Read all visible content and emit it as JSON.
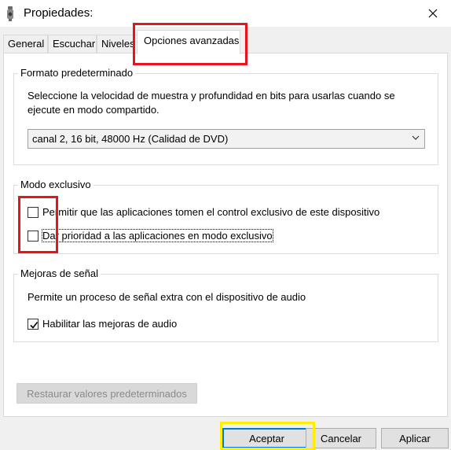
{
  "window": {
    "title": "Propiedades:",
    "icon": "speaker-icon",
    "close_icon": "close-icon"
  },
  "tabs": [
    {
      "label": "General",
      "active": false
    },
    {
      "label": "Escuchar",
      "active": false
    },
    {
      "label": "Niveles",
      "active": false
    },
    {
      "label": "Opciones avanzadas",
      "active": true
    }
  ],
  "default_format": {
    "title": "Formato predeterminado",
    "description": "Seleccione la velocidad de muestra y profundidad en bits para usarlas cuando se ejecute en modo compartido.",
    "selected": "canal 2, 16 bit, 48000 Hz (Calidad de DVD)"
  },
  "exclusive_mode": {
    "title": "Modo exclusivo",
    "allow_exclusive": {
      "label": "Permitir que las aplicaciones tomen el control exclusivo de este dispositivo",
      "checked": false
    },
    "priority": {
      "label": "Dar prioridad a las aplicaciones en modo exclusivo",
      "checked": false
    }
  },
  "signal_enhancements": {
    "title": "Mejoras de señal",
    "description": "Permite un proceso de señal extra con el dispositivo de audio",
    "enable": {
      "label": "Habilitar las mejoras de audio",
      "checked": true
    }
  },
  "buttons": {
    "restore": "Restaurar valores predeterminados",
    "restore_enabled": false,
    "accept": "Aceptar",
    "cancel": "Cancelar",
    "apply": "Aplicar"
  },
  "annotations": {
    "red": "#e8131b",
    "yellow": "#ffee00"
  }
}
